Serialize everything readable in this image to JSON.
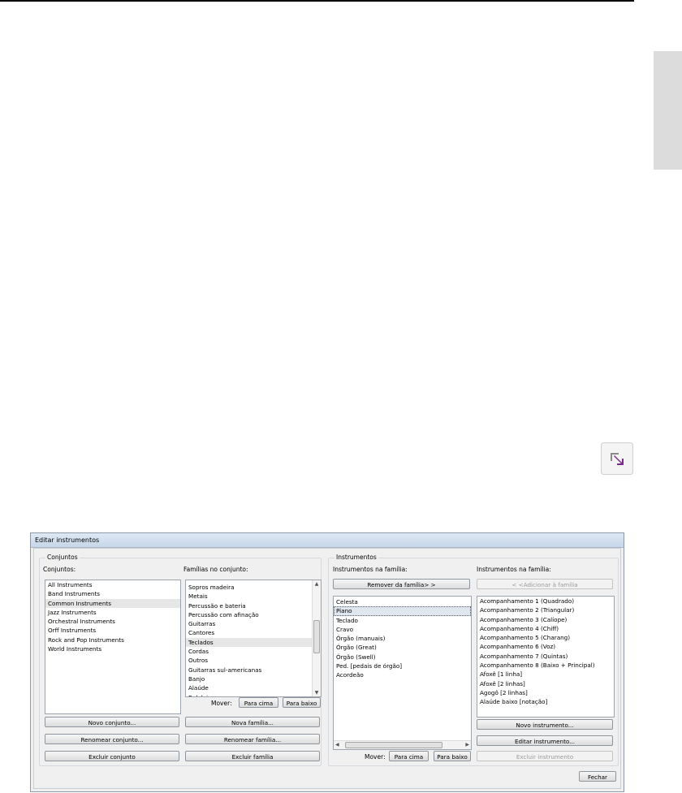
{
  "dialog": {
    "title": "Editar instrumentos",
    "close_label": "Fechar"
  },
  "conjuntos": {
    "group_title": "Conjuntos",
    "list_label": "Conjuntos:",
    "items": [
      "All Instruments",
      "Band Instruments",
      "Common Instruments",
      "Jazz Instruments",
      "Orchestral Instruments",
      "Orff Instruments",
      "Rock and Pop Instruments",
      "World Instruments"
    ],
    "selected": "Common Instruments",
    "new_button": "Novo conjunto...",
    "rename_button": "Renomear conjunto...",
    "delete_button": "Excluir conjunto"
  },
  "familias": {
    "list_label": "Famílias no conjunto:",
    "items": [
      "Sopros madeira",
      "Metais",
      "Percussão e bateria",
      "Percussão com afinação",
      "Guitarras",
      "Cantores",
      "Teclados",
      "Cordas",
      "Outros",
      "Guitarras sul-americanas",
      "Banjo",
      "Alaúde",
      "Balalaica"
    ],
    "selected": "Teclados",
    "move_label": "Mover:",
    "up_button": "Para cima",
    "down_button": "Para baixo",
    "new_button": "Nova família...",
    "rename_button": "Renomear família...",
    "delete_button": "Excluir família"
  },
  "instrumentos": {
    "group_title": "Instrumentos",
    "list_label": "Instrumentos na família:",
    "remove_button": "Remover da família> >",
    "items": [
      "Celesta",
      "Piano",
      "Teclado",
      "Cravo",
      "Órgão (manuais)",
      "Órgão (Great)",
      "Órgão (Swell)",
      "Ped. [pedais de órgão]",
      "Acordeão"
    ],
    "selected": "Piano",
    "move_label": "Mover:",
    "up_button": "Para cima",
    "down_button": "Para baixo"
  },
  "disponiveis": {
    "list_label": "Instrumentos na família:",
    "add_button": "< <Adicionar à família",
    "items": [
      "Acompanhamento 1 (Quadrado)",
      "Acompanhamento 2 (Triangular)",
      "Acompanhamento 3 (Calíope)",
      "Acompanhamento 4 (Chiff)",
      "Acompanhamento 5 (Charang)",
      "Acompanhamento 6 (Voz)",
      "Acompanhamento 7 (Quintas)",
      "Acompanhamento 8 (Baixo + Principal)",
      "Afoxê [1 linha]",
      "Afoxê [2 linhas]",
      "Agogô [2 linhas]",
      "Alaúde baixo [notação]"
    ],
    "new_button": "Novo instrumento...",
    "edit_button": "Editar instrumento...",
    "delete_button": "Excluir instrumento"
  },
  "icons": {
    "page_icon": "resize-corner-icon",
    "accent": "#7b2a8c"
  }
}
